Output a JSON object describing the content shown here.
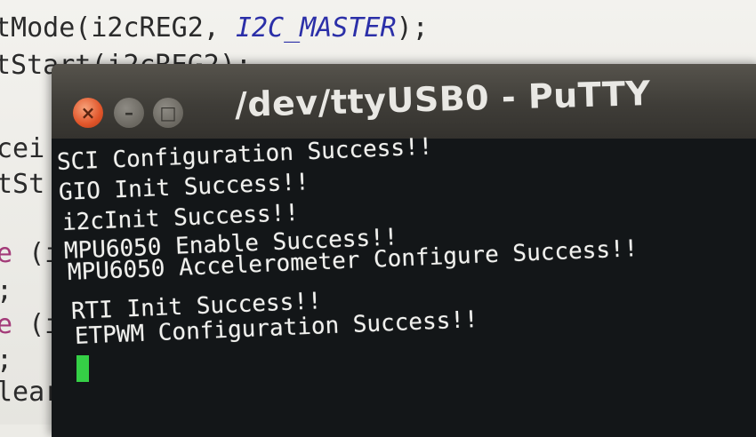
{
  "editor": {
    "lines": [
      {
        "pre": "tMode(i2cREG2, ",
        "kw": "I2C_MASTER",
        "post": ");"
      },
      {
        "pre": "tStart(i2cREG2);",
        "kw": "",
        "post": ""
      },
      {
        "pre": "cei",
        "kw": "",
        "post": ""
      },
      {
        "pre": "tSt",
        "kw": "",
        "post": ""
      },
      {
        "pre": "",
        "kw2": "e",
        "post": " (i"
      },
      {
        "pre": ";",
        "kw": "",
        "post": ""
      },
      {
        "pre": "",
        "kw2": "e",
        "post": " (i"
      },
      {
        "pre": ";",
        "kw": "",
        "post": ""
      },
      {
        "pre": "lear",
        "kw": "",
        "post": ""
      }
    ]
  },
  "window": {
    "title": "/dev/ttyUSB0 - PuTTY",
    "close_glyph": "×",
    "min_glyph": "–",
    "max_glyph": "□"
  },
  "terminal": {
    "lines": [
      "SCI Configuration Success!!",
      "GIO Init Success!!",
      "i2cInit Success!!",
      "MPU6050 Enable Success!!",
      "MPU6050 Accelerometer Configure Success!!",
      "RTI Init Success!!",
      "ETPWM Configuration Success!!"
    ],
    "cursor_color": "#35d046"
  },
  "colors": {
    "terminal_bg": "#131618",
    "terminal_fg": "#f1f1ee",
    "close_button": "#e0552a",
    "titlebar": "#3f3d38"
  }
}
